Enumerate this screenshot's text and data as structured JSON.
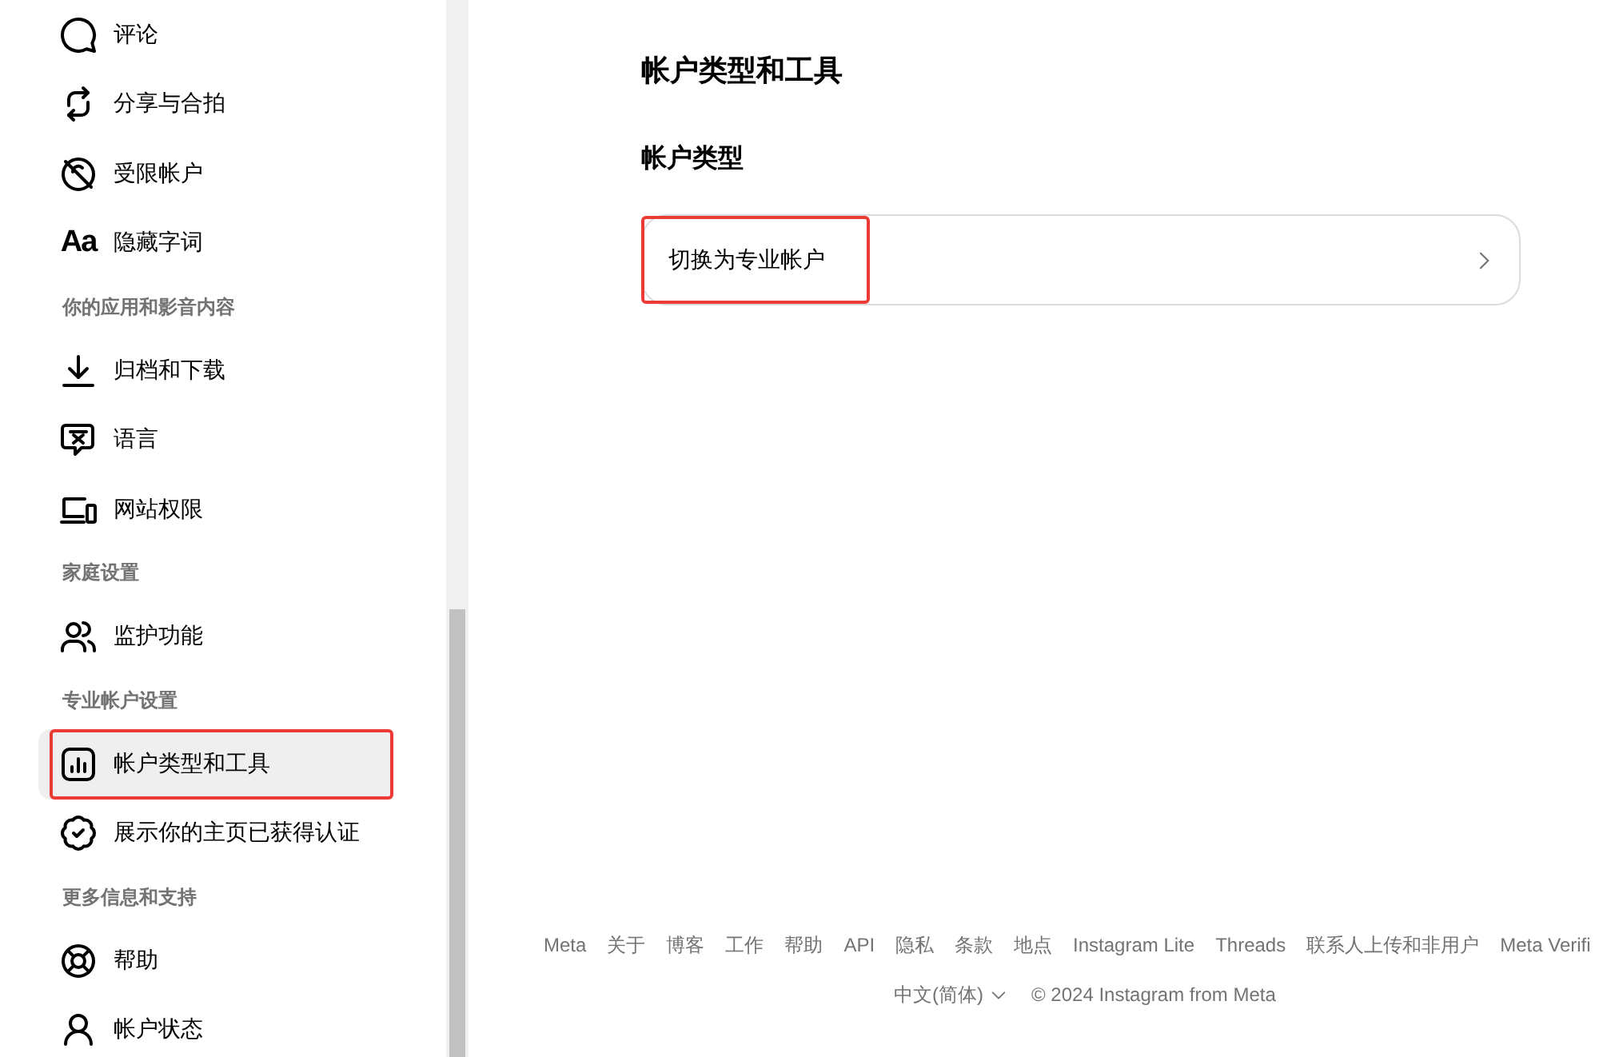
{
  "sidebar": {
    "groups": [
      {
        "items": [
          {
            "label": "评论",
            "selected": false,
            "outlined": false
          },
          {
            "label": "分享与合拍",
            "selected": false,
            "outlined": false
          },
          {
            "label": "受限帐户",
            "selected": false,
            "outlined": false
          },
          {
            "label": "隐藏字词",
            "selected": false,
            "outlined": false,
            "icon_text": "Aa"
          }
        ]
      },
      {
        "title": "你的应用和影音内容",
        "items": [
          {
            "label": "归档和下载",
            "selected": false,
            "outlined": false
          },
          {
            "label": "语言",
            "selected": false,
            "outlined": false
          },
          {
            "label": "网站权限",
            "selected": false,
            "outlined": false
          }
        ]
      },
      {
        "title": "家庭设置",
        "items": [
          {
            "label": "监护功能",
            "selected": false,
            "outlined": false
          }
        ]
      },
      {
        "title": "专业帐户设置",
        "items": [
          {
            "label": "帐户类型和工具",
            "selected": true,
            "outlined": true
          },
          {
            "label": "展示你的主页已获得认证",
            "selected": false,
            "outlined": false
          }
        ]
      },
      {
        "title": "更多信息和支持",
        "items": [
          {
            "label": "帮助",
            "selected": false,
            "outlined": false
          },
          {
            "label": "帐户状态",
            "selected": false,
            "outlined": false
          }
        ]
      }
    ]
  },
  "main": {
    "title": "帐户类型和工具",
    "sections": [
      {
        "heading": "帐户类型",
        "rows": [
          {
            "label": "切换为专业帐户",
            "outlined": true
          }
        ]
      }
    ]
  },
  "footer": {
    "links": [
      "Meta",
      "关于",
      "博客",
      "工作",
      "帮助",
      "API",
      "隐私",
      "条款",
      "地点",
      "Instagram Lite",
      "Threads",
      "联系人上传和非用户",
      "Meta Verifi"
    ],
    "language": "中文(简体)",
    "copyright": "© 2024 Instagram from Meta"
  }
}
